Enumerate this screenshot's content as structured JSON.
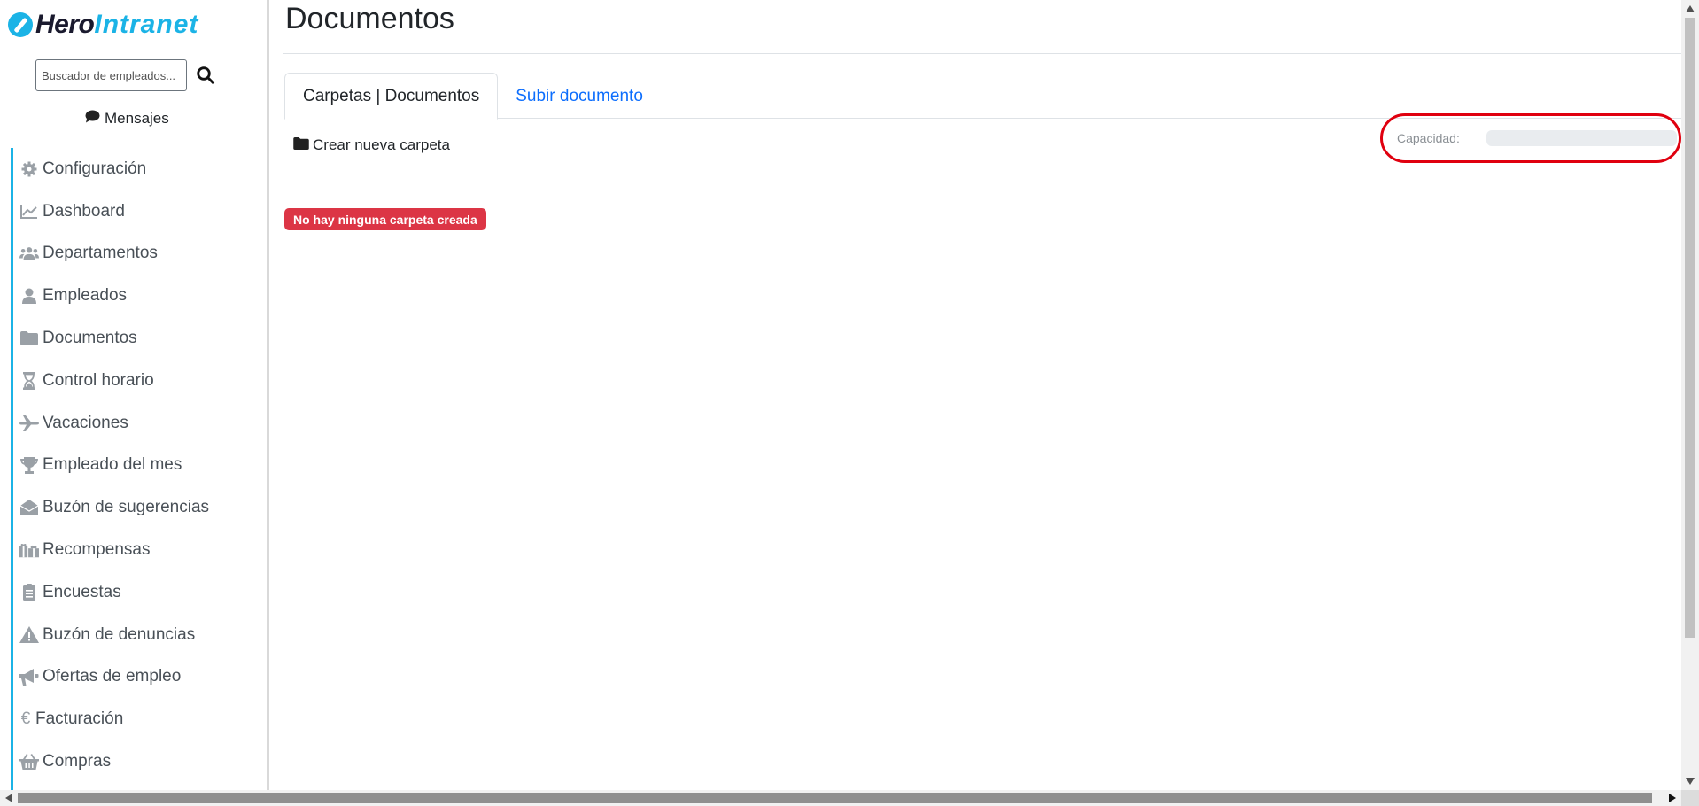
{
  "brand": {
    "name_part1": "Hero",
    "name_part2": "Intranet",
    "accent": "#1bb3e6"
  },
  "search": {
    "placeholder": "Buscador de empleados..."
  },
  "messages": {
    "label": "Mensajes"
  },
  "sidebar": {
    "items": [
      {
        "label": "Configuración",
        "icon": "gear-icon"
      },
      {
        "label": "Dashboard",
        "icon": "chart-line-icon"
      },
      {
        "label": "Departamentos",
        "icon": "users-icon"
      },
      {
        "label": "Empleados",
        "icon": "user-icon"
      },
      {
        "label": "Documentos",
        "icon": "folder-icon"
      },
      {
        "label": "Control horario",
        "icon": "hourglass-icon"
      },
      {
        "label": "Vacaciones",
        "icon": "plane-icon"
      },
      {
        "label": "Empleado del mes",
        "icon": "trophy-icon"
      },
      {
        "label": "Buzón de sugerencias",
        "icon": "envelope-open-icon"
      },
      {
        "label": "Recompensas",
        "icon": "gifts-icon"
      },
      {
        "label": "Encuestas",
        "icon": "clipboard-list-icon"
      },
      {
        "label": "Buzón de denuncias",
        "icon": "warning-icon"
      },
      {
        "label": "Ofertas de empleo",
        "icon": "megaphone-icon"
      },
      {
        "label": "Facturación",
        "icon": "euro-icon"
      },
      {
        "label": "Compras",
        "icon": "basket-icon"
      }
    ]
  },
  "main": {
    "title": "Documentos",
    "tabs": [
      {
        "label": "Carpetas | Documentos",
        "active": true
      },
      {
        "label": "Subir documento",
        "active": false
      }
    ],
    "new_folder_label": "Crear nueva carpeta",
    "capacity": {
      "label": "Capacidad:",
      "fraction": 0,
      "highlight_color": "#e0000f"
    },
    "empty_badge": "No hay ninguna carpeta creada"
  },
  "colors": {
    "badge": "#dc3545",
    "link": "#0d6efd"
  }
}
